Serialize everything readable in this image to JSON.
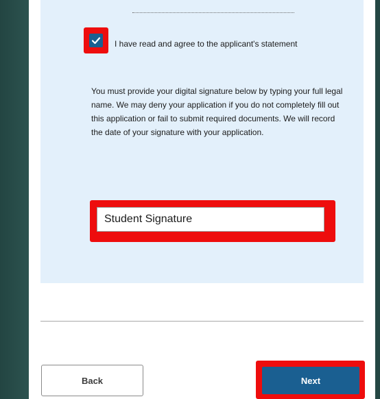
{
  "agreement": {
    "checkbox_checked": true,
    "label": "I have read and agree to the applicant's statement"
  },
  "instructions": "You must provide your digital signature below by typing your full legal name. We may deny your application if you do not completely fill out this application or fail to submit required documents. We will record the date of your signature with your application.",
  "signature": {
    "value": "Student Signature"
  },
  "buttons": {
    "back_label": "Back",
    "next_label": "Next"
  },
  "icons": {
    "checkbox": "checkmark-icon"
  },
  "colors": {
    "backdrop": "#2f5753",
    "panel": "#e3f0fb",
    "primary": "#1a5f91",
    "highlight": "#ee0d0d"
  }
}
